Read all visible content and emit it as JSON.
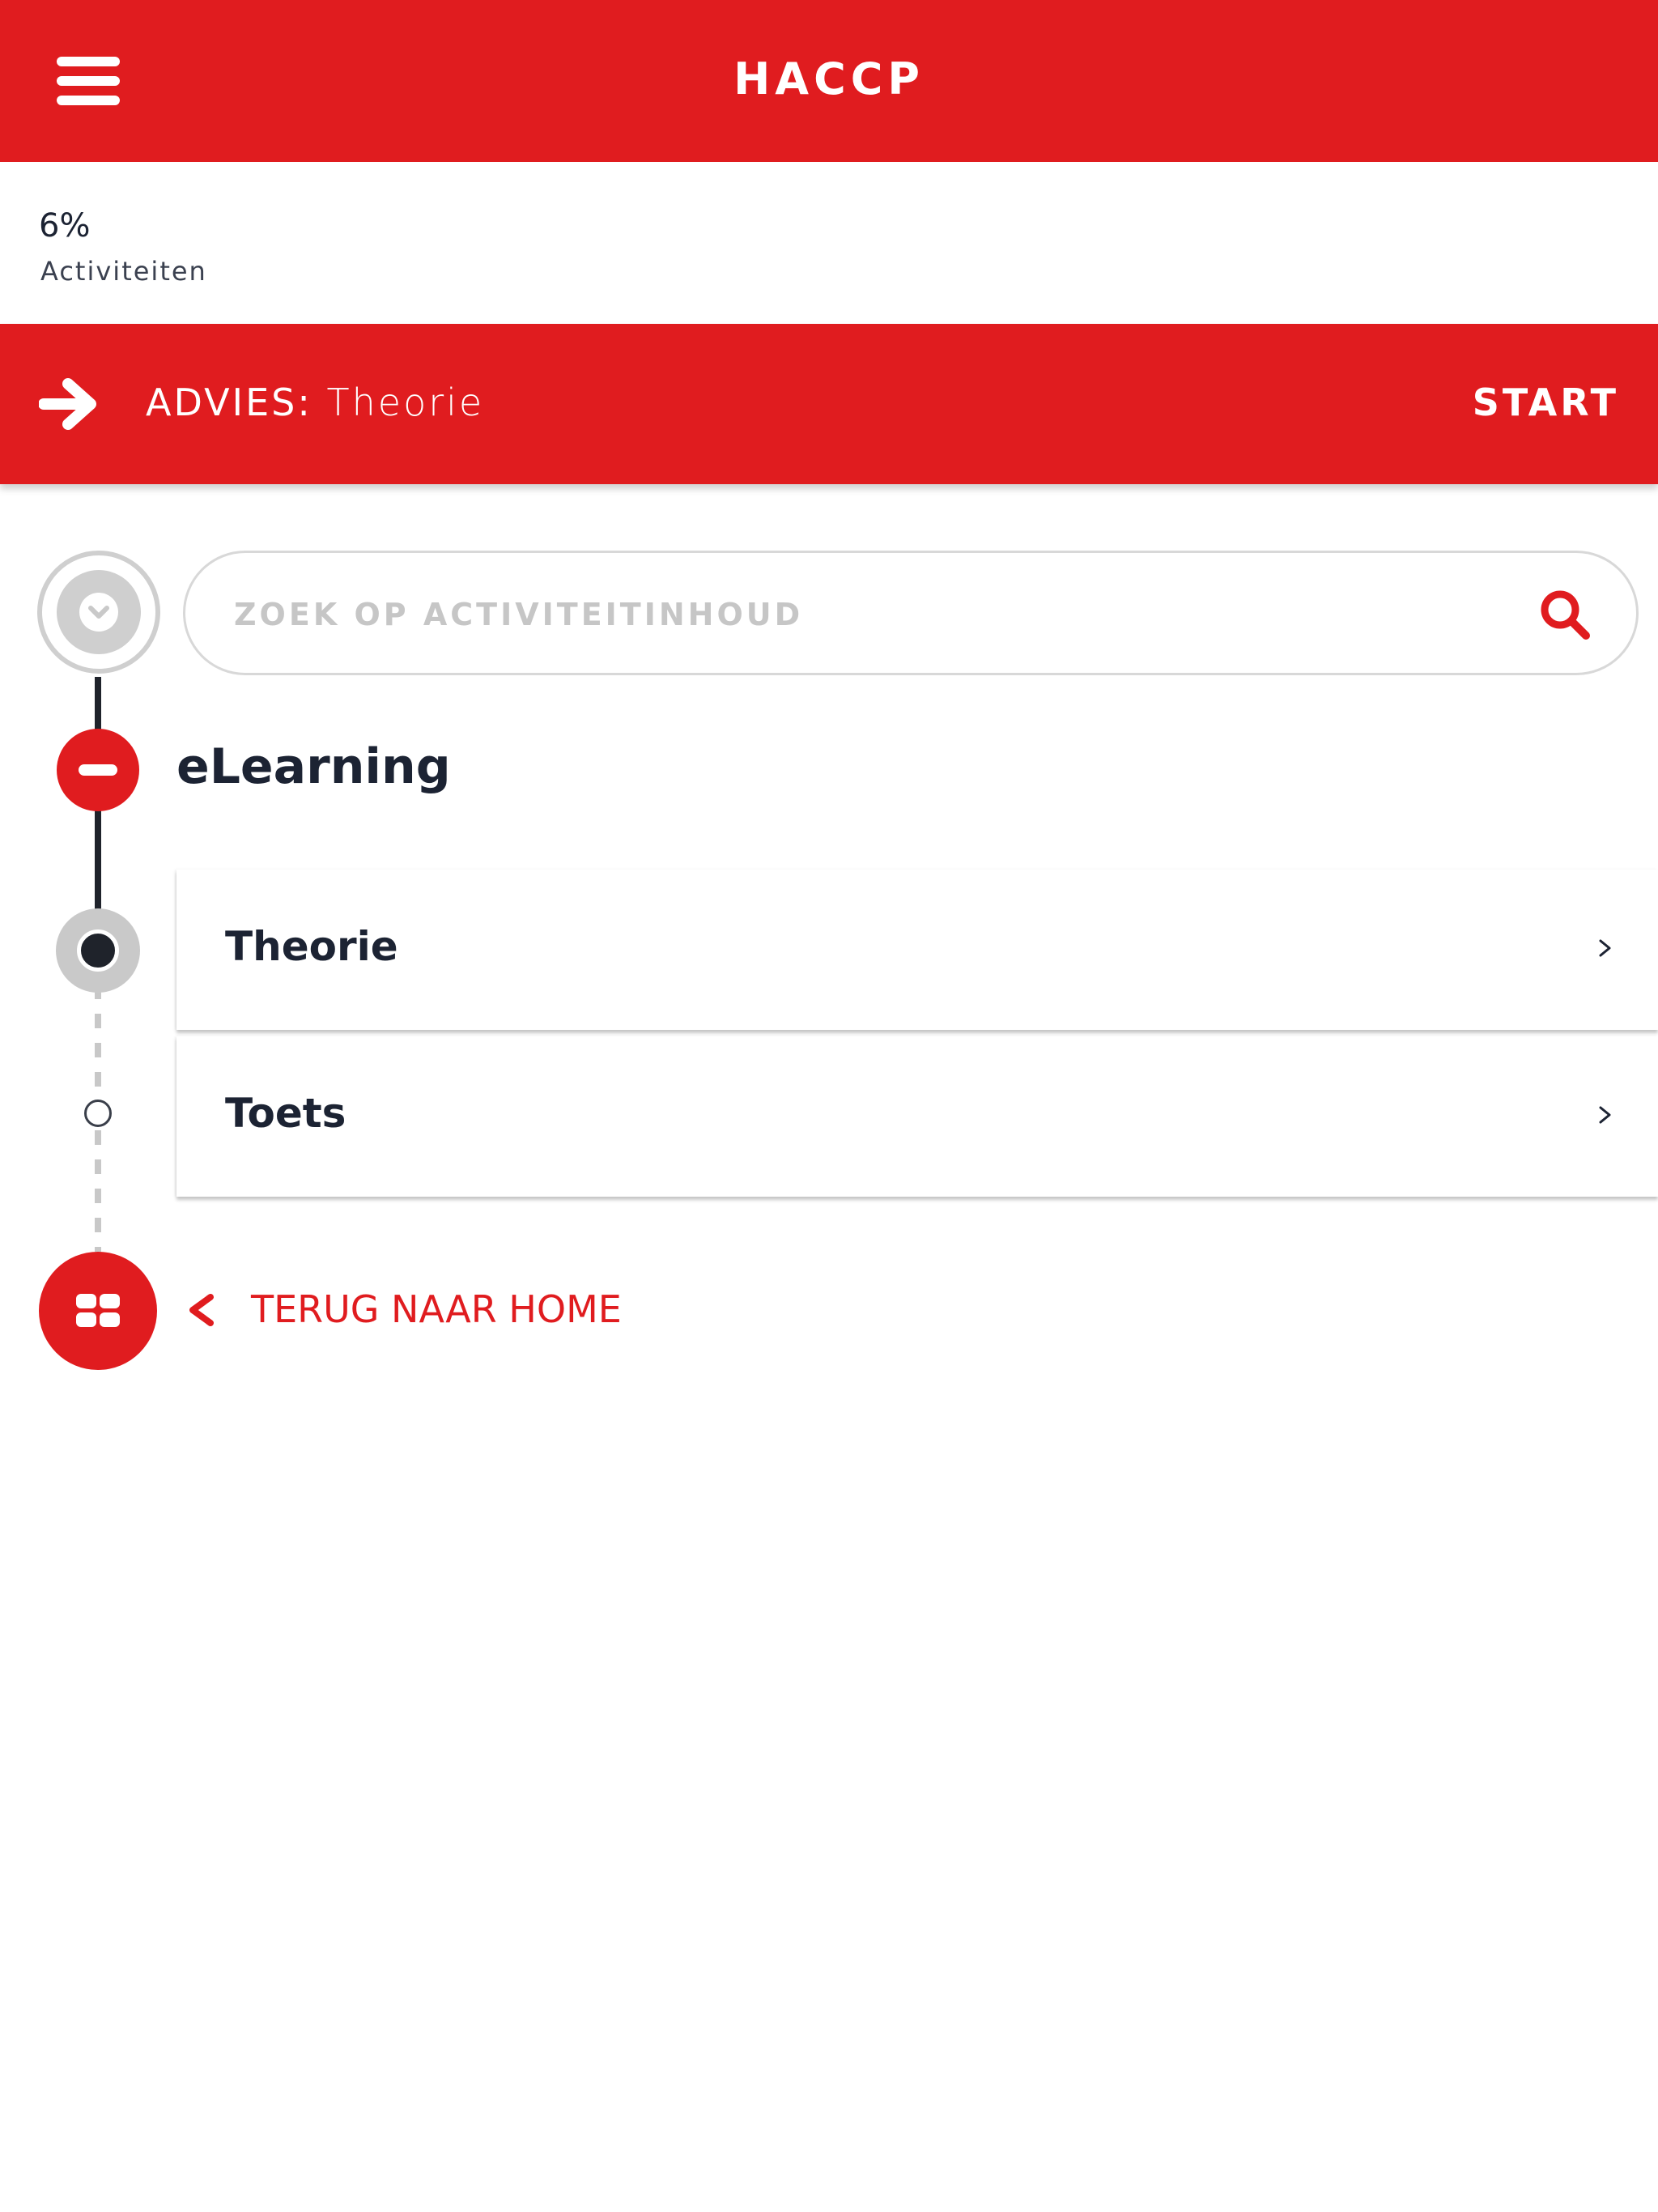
{
  "header": {
    "title": "HACCP",
    "menu_icon": "hamburger-menu-icon"
  },
  "progress": {
    "value_text": "6%",
    "value": 0.06,
    "label": "Activiteiten"
  },
  "advice": {
    "prefix": "ADVIES:",
    "item": "Theorie",
    "start_label": "START",
    "icon": "arrow-right-icon"
  },
  "search": {
    "placeholder": "ZOEK OP ACTIVITEITINHOUD",
    "value": "",
    "icon": "search-icon"
  },
  "section": {
    "title": "eLearning",
    "activities": [
      {
        "label": "Theorie",
        "status": "current"
      },
      {
        "label": "Toets",
        "status": "open"
      }
    ]
  },
  "footer": {
    "back_label": "TERUG NAAR HOME",
    "home_icon": "grid-icon"
  },
  "colors": {
    "accent": "#e01c1f",
    "text": "#1c2333",
    "muted": "#c6c6c6"
  }
}
